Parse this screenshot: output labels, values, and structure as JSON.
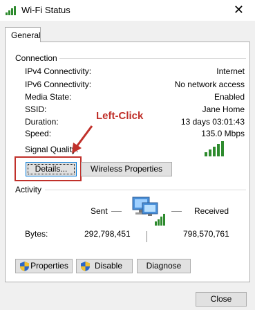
{
  "window": {
    "title": "Wi-Fi Status",
    "close_glyph": "✕"
  },
  "tabs": [
    {
      "label": "General"
    }
  ],
  "connection": {
    "group_label": "Connection",
    "rows": [
      {
        "label": "IPv4 Connectivity:",
        "value": "Internet"
      },
      {
        "label": "IPv6 Connectivity:",
        "value": "No network access"
      },
      {
        "label": "Media State:",
        "value": "Enabled"
      },
      {
        "label": "SSID:",
        "value": "Jane Home"
      },
      {
        "label": "Duration:",
        "value": "13 days 03:01:43"
      },
      {
        "label": "Speed:",
        "value": "135.0 Mbps"
      }
    ],
    "signal_label": "Signal Quality:",
    "signal_bars": 5,
    "details_button": "Details...",
    "wireless_button": "Wireless Properties"
  },
  "annotation": {
    "text": "Left-Click",
    "color": "#c0302a"
  },
  "activity": {
    "group_label": "Activity",
    "sent_label": "Sent",
    "received_label": "Received",
    "bytes_label": "Bytes:",
    "bytes_sent": "292,798,451",
    "bytes_received": "798,570,761"
  },
  "bottom_buttons": {
    "properties": "Properties",
    "disable": "Disable",
    "diagnose": "Diagnose"
  },
  "footer": {
    "close_button": "Close"
  },
  "colors": {
    "accent": "#0078d7",
    "signal": "#2e8b2e",
    "annotation": "#c0302a"
  },
  "icons": {
    "title": "wifi-signal-icon",
    "network": "network-computers-icon",
    "shield": "uac-shield-icon"
  }
}
